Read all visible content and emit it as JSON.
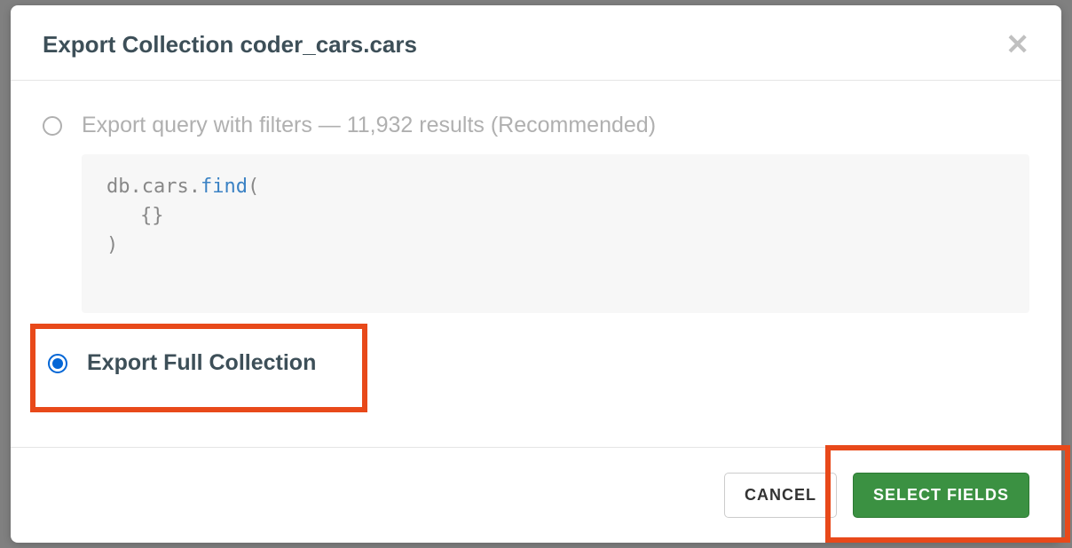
{
  "modal": {
    "title": "Export Collection coder_cars.cars",
    "options": {
      "query_filters": {
        "label": "Export query with filters — 11,932 results (Recommended)",
        "selected": false,
        "code": {
          "line1_prefix": "db.cars.",
          "line1_method": "find",
          "line1_open": "(",
          "line2": "{}",
          "line3": ")"
        }
      },
      "full_collection": {
        "label": "Export Full Collection",
        "selected": true
      }
    },
    "footer": {
      "cancel": "CANCEL",
      "primary": "SELECT FIELDS"
    }
  }
}
